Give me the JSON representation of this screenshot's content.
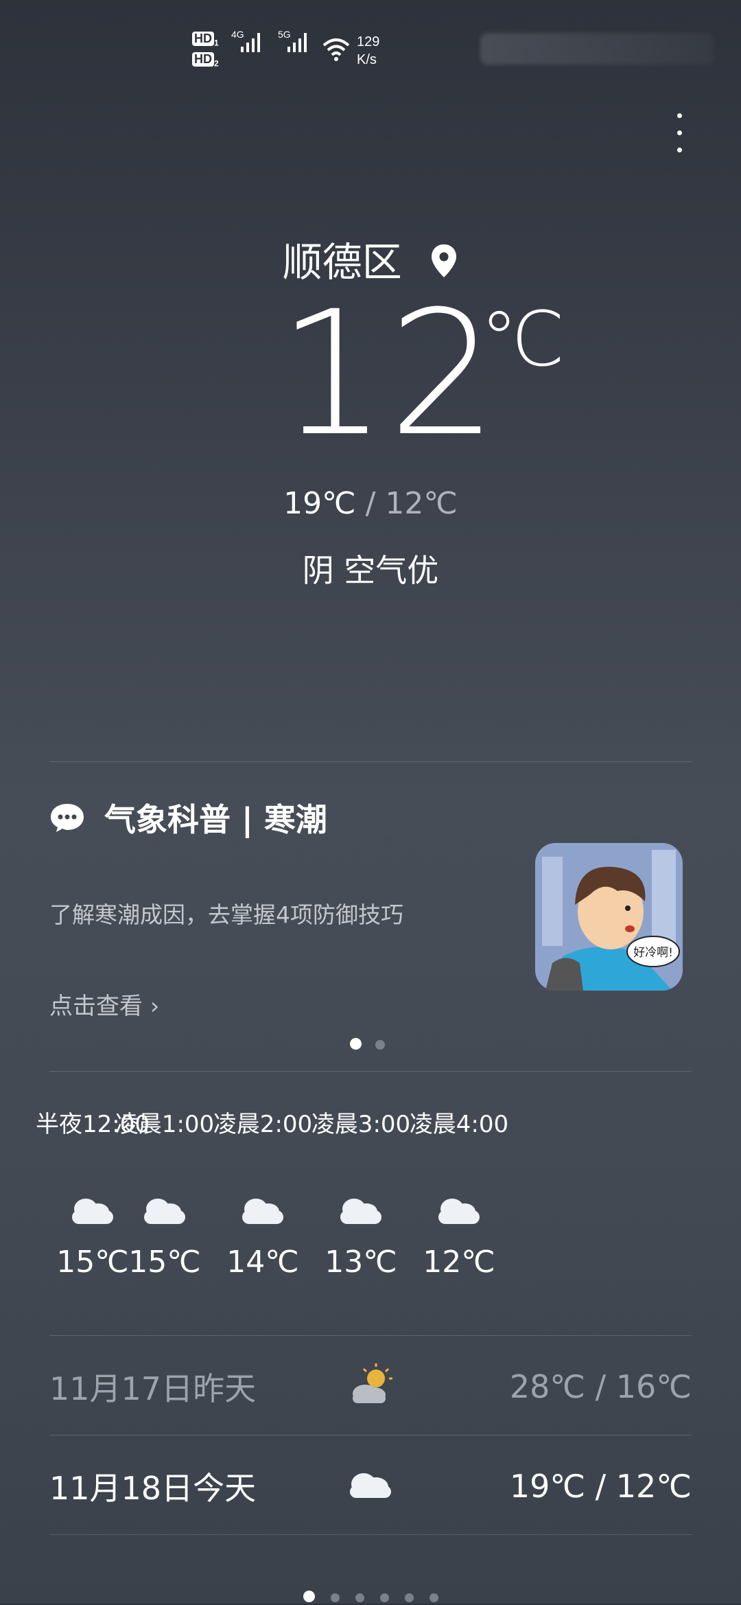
{
  "status_bar": {
    "hd1": "HD",
    "hd1_sub": "1",
    "hd2": "HD",
    "hd2_sub": "2",
    "net1": "4G",
    "net2": "5G",
    "speed_value": "129",
    "speed_unit": "K/s"
  },
  "location": {
    "name": "顺德区"
  },
  "current": {
    "temp": "12",
    "unit": "℃",
    "high": "19℃",
    "separator": "/",
    "low": "12℃",
    "condition": "阴  空气优"
  },
  "card": {
    "title": "气象科普 | 寒潮",
    "description": "了解寒潮成因，去掌握4项防御技巧",
    "link": "点击查看 ›",
    "image_caption": "好冷啊!",
    "page_count": 2,
    "active_page": 1
  },
  "hourly": [
    {
      "time": "半夜12:00",
      "icon": "cloud-icon",
      "temp": "15℃"
    },
    {
      "time": "凌晨1:00",
      "icon": "cloud-icon",
      "temp": "15℃"
    },
    {
      "time": "凌晨2:00",
      "icon": "cloud-icon",
      "temp": "14℃"
    },
    {
      "time": "凌晨3:00",
      "icon": "cloud-icon",
      "temp": "13℃"
    },
    {
      "time": "凌晨4:00",
      "icon": "cloud-icon",
      "temp": "12℃"
    }
  ],
  "daily": [
    {
      "date": "11月17日昨天",
      "icon": "partly-sunny-icon",
      "temps": "28℃ / 16℃"
    },
    {
      "date": "11月18日今天",
      "icon": "cloud-icon",
      "temps": "19℃ / 12℃"
    }
  ],
  "pager": {
    "count": 6,
    "active": 1
  },
  "colors": {
    "bg_top": "#2d323b",
    "bg_mid": "#474d57",
    "muted": "#aeb3bb",
    "sun": "#e8b53c"
  }
}
